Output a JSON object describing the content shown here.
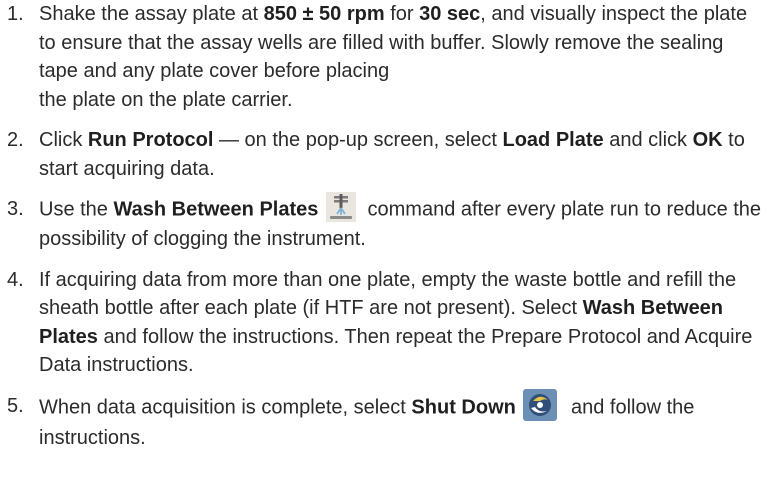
{
  "steps": [
    {
      "num": "1.",
      "parts": [
        "Shake the assay plate at ",
        "850 ± 50 rpm",
        " for ",
        "30 sec",
        ", and visually inspect the plate to ensure that the assay wells are filled with buffer. Slowly remove the sealing tape and any plate cover before placing",
        "the plate on the plate carrier."
      ]
    },
    {
      "num": "2.",
      "parts": [
        "Click ",
        "Run Protocol",
        " — on the pop-up screen, select ",
        "Load Plate",
        " and click ",
        "OK",
        " to start acquiring data."
      ]
    },
    {
      "num": "3.",
      "parts": [
        "Use the ",
        "Wash Between Plates",
        "command after every plate run to reduce the possibility of clogging the instrument."
      ],
      "icon": "wash-between-plates-icon"
    },
    {
      "num": "4.",
      "parts": [
        "If acquiring data from more than one plate, empty the waste bottle and refill the sheath bottle after each plate (if HTF are not present). Select ",
        "Wash Between Plates",
        " and follow the instructions. Then repeat the Prepare Protocol and Acquire Data instructions."
      ]
    },
    {
      "num": "5.",
      "parts": [
        "When data acquisition is complete, select ",
        "Shut Down",
        "and follow the instructions."
      ],
      "icon": "shut-down-icon"
    }
  ]
}
